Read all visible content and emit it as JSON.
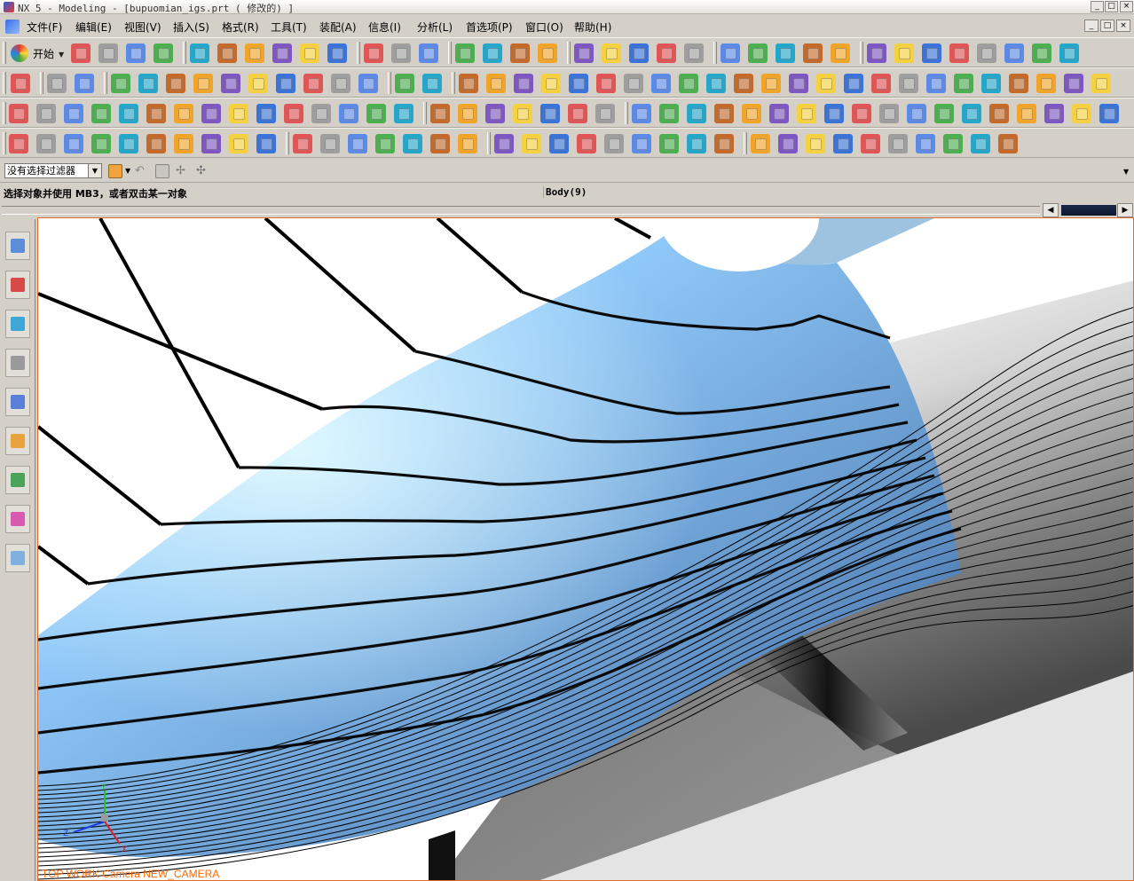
{
  "window": {
    "title": "NX 5 - Modeling - [bupuomian_igs.prt ( 修改的) ]",
    "controls": [
      "_",
      "□",
      "×"
    ]
  },
  "menu": {
    "items": [
      "文件(F)",
      "编辑(E)",
      "视图(V)",
      "插入(S)",
      "格式(R)",
      "工具(T)",
      "装配(A)",
      "信息(I)",
      "分析(L)",
      "首选项(P)",
      "窗口(O)",
      "帮助(H)"
    ],
    "mdi_controls": [
      "_",
      "□",
      "×"
    ]
  },
  "toolbar": {
    "start_label": "开始"
  },
  "selection_bar": {
    "filter_value": "没有选择过滤器"
  },
  "status": {
    "cue_text": "选择对象并使用 MB3，或者双击某一对象",
    "selection_text": "Body(9)"
  },
  "viewport": {
    "caption": "TOP WORK Camera NEW_CAMERA",
    "triad_labels": {
      "x": "X",
      "y": "Y",
      "z": "Z"
    },
    "caption_color": "#ff6a00",
    "surface_color": "#8fc8f8"
  },
  "resource_bar": {
    "tabs": [
      "assembly-navigator-icon",
      "part-navigator-icon",
      "web-browser-icon",
      "history-icon",
      "reuse-library-icon",
      "roles-icon",
      "system-materials-icon",
      "palette-icon",
      "roles-person-icon",
      "display-icon"
    ]
  }
}
